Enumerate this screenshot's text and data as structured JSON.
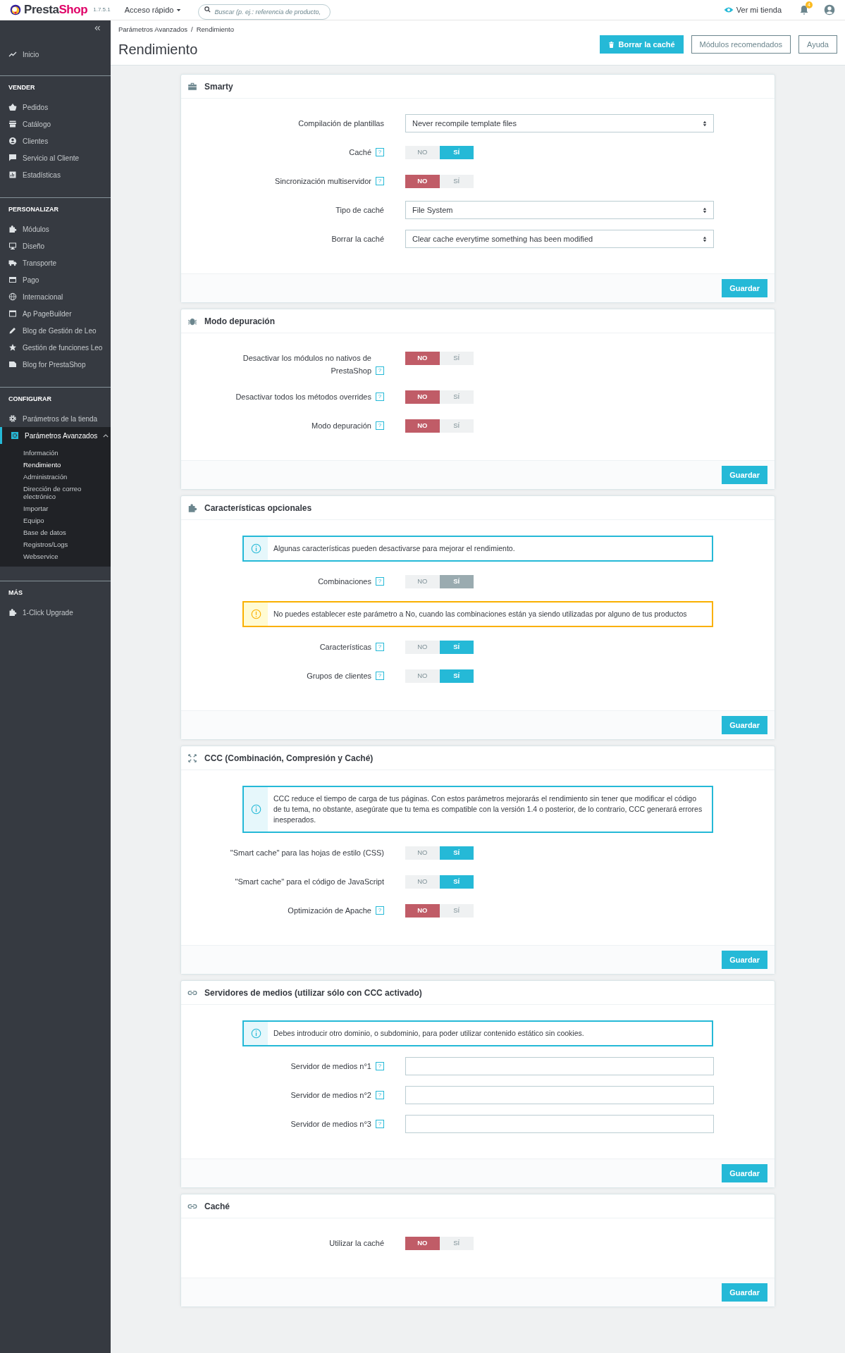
{
  "topbar": {
    "logo": [
      "Presta",
      "Shop"
    ],
    "version": "1.7.5.1",
    "quick_access": "Acceso rápido",
    "search": {
      "placeholder": "Buscar (p. ej.: referencia de producto,"
    },
    "store_link": "Ver mi tienda",
    "notifications_count": "4"
  },
  "sidebar": {
    "home": {
      "label": "Inicio",
      "selected": false
    },
    "sections": [
      {
        "title": "VENDER",
        "items": [
          {
            "label": "Pedidos",
            "selected": false
          },
          {
            "label": "Catálogo",
            "selected": false
          },
          {
            "label": "Clientes",
            "selected": false
          },
          {
            "label": "Servicio al Cliente",
            "selected": false
          },
          {
            "label": "Estadísticas",
            "selected": false
          }
        ]
      },
      {
        "title": "PERSONALIZAR",
        "items": [
          {
            "label": "Módulos",
            "selected": false
          },
          {
            "label": "Diseño",
            "selected": false
          },
          {
            "label": "Transporte",
            "selected": false
          },
          {
            "label": "Pago",
            "selected": false
          },
          {
            "label": "Internacional",
            "selected": false
          },
          {
            "label": "Ap PageBuilder",
            "selected": false
          },
          {
            "label": "Blog de Gestión de Leo",
            "selected": false
          },
          {
            "label": "Gestión de funciones Leo",
            "selected": false
          },
          {
            "label": "Blog for PrestaShop",
            "selected": false
          }
        ]
      },
      {
        "title": "CONFIGURAR",
        "items": [
          {
            "label": "Parámetros de la tienda",
            "selected": false
          },
          {
            "label": "Parámetros Avanzados",
            "selected": true,
            "expanded": true,
            "children": [
              {
                "label": "Información",
                "selected": false
              },
              {
                "label": "Rendimiento",
                "selected": true
              },
              {
                "label": "Administración",
                "selected": false
              },
              {
                "label": "Dirección de correo electrónico",
                "selected": false
              },
              {
                "label": "Importar",
                "selected": false
              },
              {
                "label": "Equipo",
                "selected": false
              },
              {
                "label": "Base de datos",
                "selected": false
              },
              {
                "label": "Registros/Logs",
                "selected": false
              },
              {
                "label": "Webservice",
                "selected": false
              }
            ]
          }
        ]
      },
      {
        "title": "MÁS",
        "items": [
          {
            "label": "1-Click Upgrade",
            "selected": false
          }
        ]
      }
    ]
  },
  "header": {
    "breadcrumb": [
      "Parámetros Avanzados",
      "Rendimiento"
    ],
    "breadcrumb_separator": "/",
    "title": "Rendimiento",
    "buttons": [
      {
        "label": "Borrar la caché",
        "kind": "primary"
      },
      {
        "label": "Módulos recomendados",
        "kind": "outline"
      },
      {
        "label": "Ayuda",
        "kind": "outline"
      }
    ]
  },
  "panels": [
    {
      "title": "Smarty",
      "rows": [
        {
          "kind": "select",
          "label": "Compilación de plantillas",
          "value": "Never recompile template files"
        },
        {
          "kind": "toggle",
          "label": "Caché",
          "help": "?",
          "on": true,
          "disabled": false,
          "no_label": "NO",
          "yes_label": "SÍ"
        },
        {
          "kind": "toggle",
          "label": "Sincronización multiservidor",
          "help": "?",
          "on": false,
          "disabled": false,
          "no_label": "NO",
          "yes_label": "SÍ"
        },
        {
          "kind": "select",
          "label": "Tipo de caché",
          "value": "File System"
        },
        {
          "kind": "select",
          "label": "Borrar la caché",
          "value": "Clear cache everytime something has been modified"
        }
      ],
      "save": "Guardar"
    },
    {
      "title": "Modo depuración",
      "rows": [
        {
          "kind": "toggle",
          "label": "Desactivar los módulos no nativos de PrestaShop",
          "help": "?",
          "on": false,
          "disabled": false,
          "no_label": "NO",
          "yes_label": "SÍ"
        },
        {
          "kind": "toggle",
          "label": "Desactivar todos los métodos overrides",
          "help": "?",
          "on": false,
          "disabled": false,
          "no_label": "NO",
          "yes_label": "SÍ"
        },
        {
          "kind": "toggle",
          "label": "Modo depuración",
          "help": "?",
          "on": false,
          "disabled": false,
          "no_label": "NO",
          "yes_label": "SÍ"
        }
      ],
      "save": "Guardar"
    },
    {
      "title": "Características opcionales",
      "rows": [
        {
          "kind": "info",
          "text": "Algunas características pueden desactivarse para mejorar el rendimiento."
        },
        {
          "kind": "toggle",
          "label": "Combinaciones",
          "help": "?",
          "on": true,
          "disabled": true,
          "no_label": "NO",
          "yes_label": "SÍ"
        },
        {
          "kind": "warning",
          "text": "No puedes establecer este parámetro a No, cuando las combinaciones están ya siendo utilizadas por alguno de tus productos"
        },
        {
          "kind": "toggle",
          "label": "Características",
          "help": "?",
          "on": true,
          "disabled": false,
          "no_label": "NO",
          "yes_label": "SÍ"
        },
        {
          "kind": "toggle",
          "label": "Grupos de clientes",
          "help": "?",
          "on": true,
          "disabled": false,
          "no_label": "NO",
          "yes_label": "SÍ"
        }
      ],
      "save": "Guardar"
    },
    {
      "title": "CCC (Combinación, Compresión y Caché)",
      "rows": [
        {
          "kind": "info",
          "text": "CCC reduce el tiempo de carga de tus páginas. Con estos parámetros mejorarás el rendimiento sin tener que modificar el código de tu tema, no obstante, asegúrate que tu tema es compatible con la versión 1.4 o posterior, de lo contrario, CCC generará errores inesperados."
        },
        {
          "kind": "toggle",
          "label": "\"Smart cache\" para las hojas de estilo (CSS)",
          "on": true,
          "disabled": false,
          "no_label": "NO",
          "yes_label": "SÍ"
        },
        {
          "kind": "toggle",
          "label": "\"Smart cache\" para el código de JavaScript",
          "on": true,
          "disabled": false,
          "no_label": "NO",
          "yes_label": "SÍ"
        },
        {
          "kind": "toggle",
          "label": "Optimización de Apache",
          "help": "?",
          "on": false,
          "disabled": false,
          "no_label": "NO",
          "yes_label": "SÍ"
        }
      ],
      "save": "Guardar"
    },
    {
      "title": "Servidores de medios (utilizar sólo con CCC activado)",
      "rows": [
        {
          "kind": "info",
          "text": "Debes introducir otro dominio, o subdominio, para poder utilizar contenido estático sin cookies."
        },
        {
          "kind": "text",
          "label": "Servidor de medios n°1",
          "help": "?"
        },
        {
          "kind": "text",
          "label": "Servidor de medios n°2",
          "help": "?"
        },
        {
          "kind": "text",
          "label": "Servidor de medios n°3",
          "help": "?"
        }
      ],
      "save": "Guardar"
    },
    {
      "title": "Caché",
      "rows": [
        {
          "kind": "toggle",
          "label": "Utilizar la caché",
          "on": false,
          "disabled": false,
          "no_label": "NO",
          "yes_label": "SÍ"
        }
      ],
      "save": "Guardar"
    }
  ]
}
